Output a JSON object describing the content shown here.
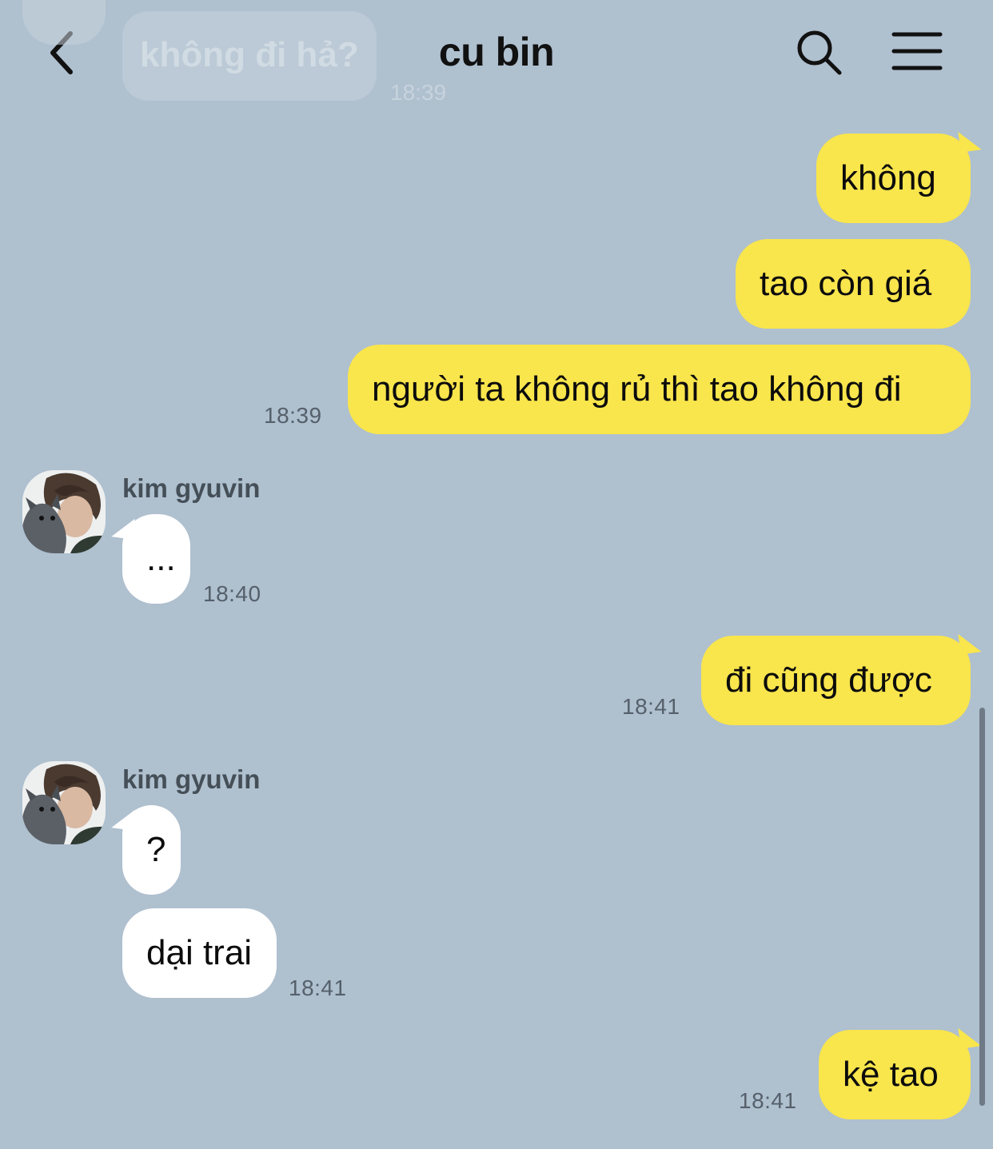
{
  "header": {
    "title": "cu bin",
    "back_icon": "chevron-left-icon",
    "search_icon": "search-icon",
    "menu_icon": "hamburger-menu-icon"
  },
  "previous": {
    "text": "không đi hả?",
    "time": "18:39"
  },
  "messages": {
    "m1": "không",
    "m2": "tao còn giá",
    "m3": "người ta không rủ thì tao không đi",
    "t1": "18:39",
    "sender1": "kim gyuvin",
    "m4": "...",
    "t2": "18:40",
    "m5": "đi cũng được",
    "t3": "18:41",
    "sender2": "kim gyuvin",
    "m6": "?",
    "m7": "dại trai",
    "t4": "18:41",
    "m8": "kệ tao",
    "t5": "18:41"
  },
  "colors": {
    "background": "#afc0cf",
    "my_bubble": "#f9e54c",
    "their_bubble": "#ffffff"
  }
}
